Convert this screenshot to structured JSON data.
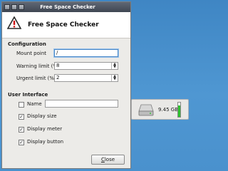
{
  "window": {
    "title": "Free Space Checker"
  },
  "header": {
    "title": "Free Space Checker"
  },
  "configuration": {
    "heading": "Configuration",
    "mount_point_label": "Mount point",
    "mount_point_value": "/",
    "warning_label": "Warning limit (%)",
    "warning_value": "8",
    "urgent_label": "Urgent limit (%)",
    "urgent_value": "2"
  },
  "ui": {
    "heading": "User Interface",
    "name_label": "Name",
    "name_value": "",
    "display_size_label": "Display size",
    "display_size_checked": true,
    "display_meter_label": "Display meter",
    "display_meter_checked": true,
    "display_button_label": "Display button",
    "display_button_checked": true
  },
  "buttons": {
    "close_label": "Close",
    "close_mnemonic": "C",
    "close_rest": "lose"
  },
  "widget": {
    "free_space": "9.45 GB",
    "meter_level": 0.82,
    "meter_color": "#2ec22e"
  },
  "icons": {
    "header_icon": "warning-icon",
    "widget_icon": "hard-drive-icon"
  },
  "colors": {
    "desktop": "#4a91cd",
    "titlebar": "#4b525d",
    "focus": "#4a88c7"
  }
}
